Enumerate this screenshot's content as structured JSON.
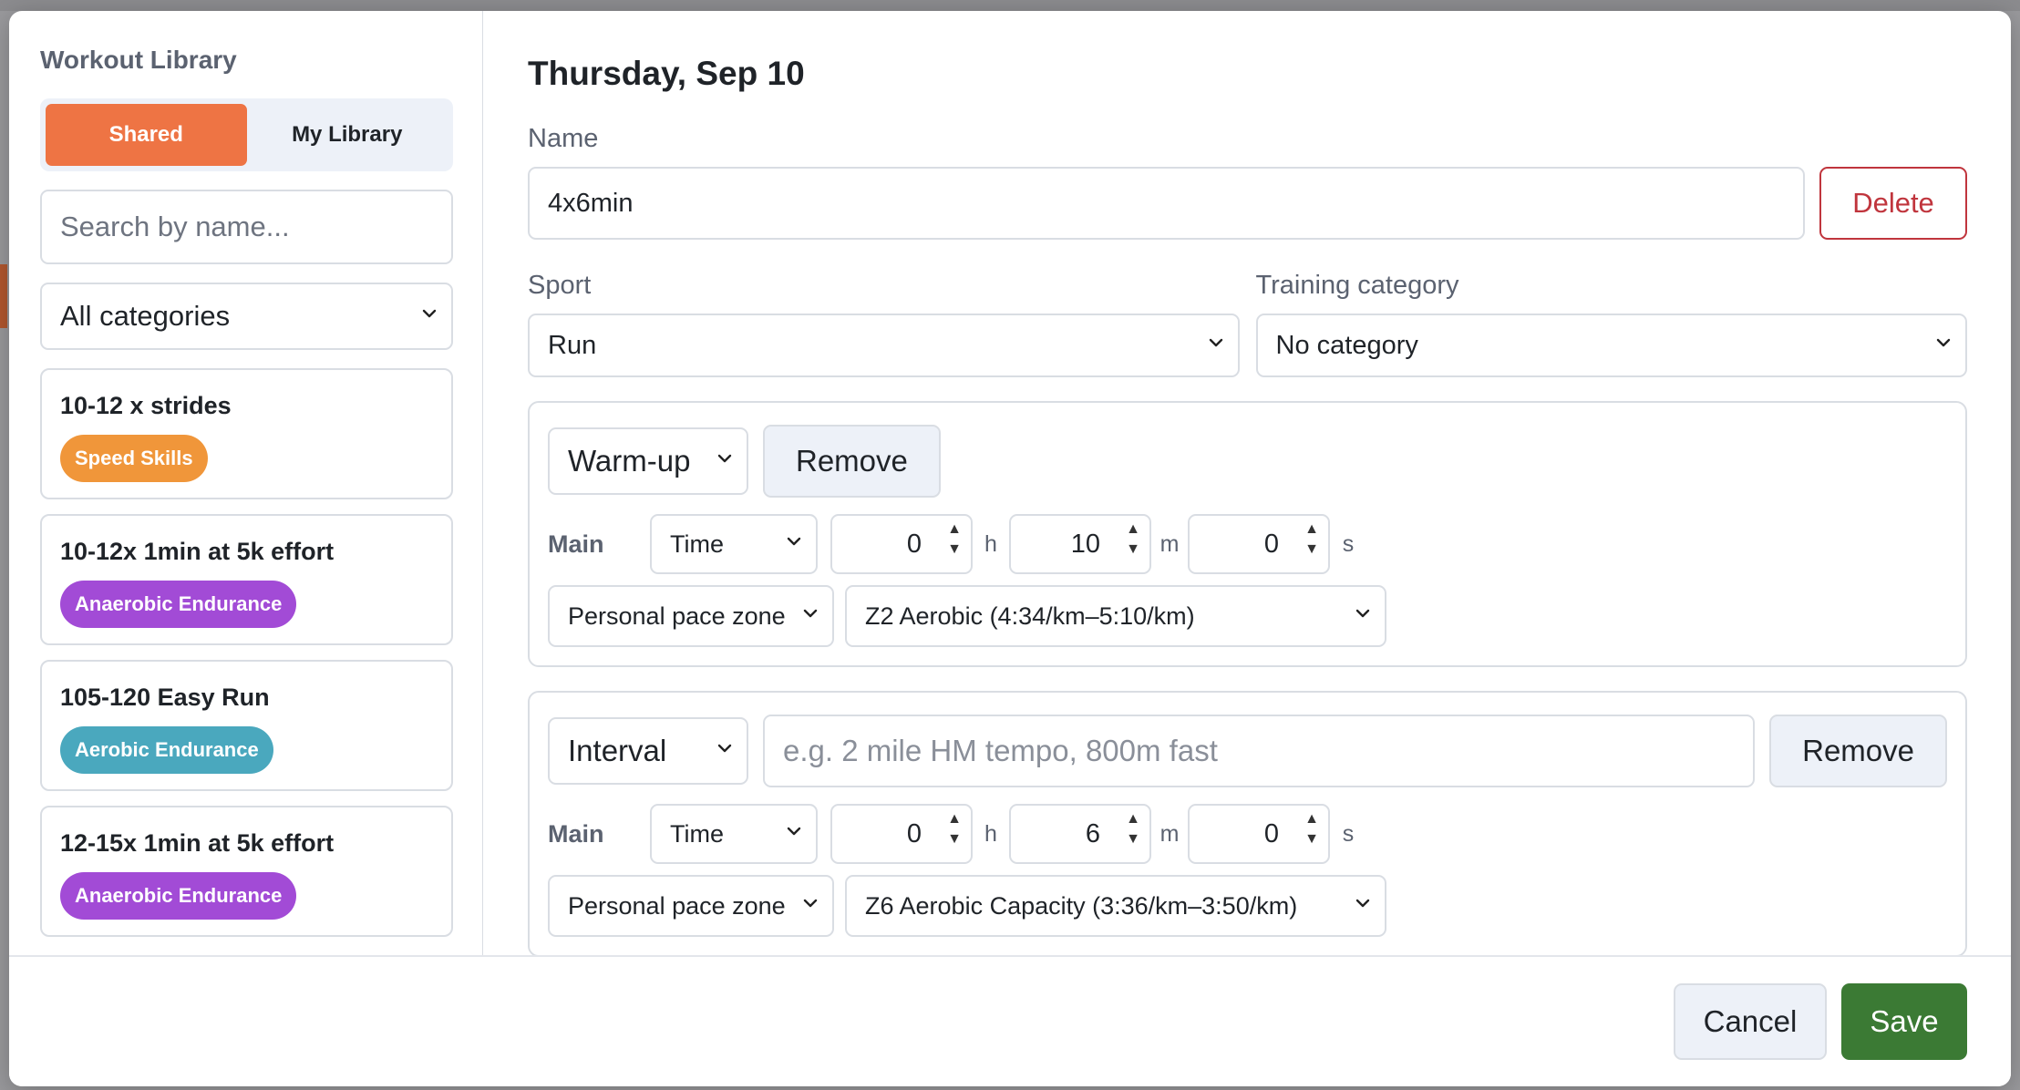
{
  "sidebar": {
    "title": "Workout Library",
    "tabs": [
      {
        "label": "Shared",
        "active": true
      },
      {
        "label": "My Library",
        "active": false
      }
    ],
    "search_placeholder": "Search by name...",
    "category_filter": "All categories",
    "workouts": [
      {
        "name": "10-12 x strides",
        "badge": "Speed Skills",
        "badge_color": "#f0963a"
      },
      {
        "name": "10-12x 1min at 5k effort",
        "badge": "Anaerobic Endurance",
        "badge_color": "#a24bd6"
      },
      {
        "name": "105-120 Easy Run",
        "badge": "Aerobic Endurance",
        "badge_color": "#4aa8be"
      },
      {
        "name": "12-15x 1min at 5k effort",
        "badge": "Anaerobic Endurance",
        "badge_color": "#a24bd6"
      }
    ]
  },
  "main": {
    "day_title": "Thursday, Sep 10",
    "name_label": "Name",
    "name_value": "4x6min",
    "delete_label": "Delete",
    "sport_label": "Sport",
    "sport_value": "Run",
    "category_label": "Training category",
    "category_value": "No category",
    "steps": [
      {
        "type": "Warm-up",
        "description_placeholder": "",
        "remove_label": "Remove",
        "duration_label": "Main",
        "duration_mode": "Time",
        "hours": "0",
        "minutes": "10",
        "seconds": "0",
        "unit_h": "h",
        "unit_m": "m",
        "unit_s": "s",
        "zone_mode": "Personal pace zone",
        "zone_value": "Z2 Aerobic (4:34/km–5:10/km)"
      },
      {
        "type": "Interval",
        "description_placeholder": "e.g. 2 mile HM tempo, 800m fast",
        "remove_label": "Remove",
        "duration_label": "Main",
        "duration_mode": "Time",
        "hours": "0",
        "minutes": "6",
        "seconds": "0",
        "unit_h": "h",
        "unit_m": "m",
        "unit_s": "s",
        "zone_mode": "Personal pace zone",
        "zone_value": "Z6 Aerobic Capacity (3:36/km–3:50/km)"
      }
    ]
  },
  "footer": {
    "cancel_label": "Cancel",
    "save_label": "Save"
  },
  "colors": {
    "accent": "#ee7444",
    "danger": "#c0353d",
    "success": "#3b7a34"
  }
}
